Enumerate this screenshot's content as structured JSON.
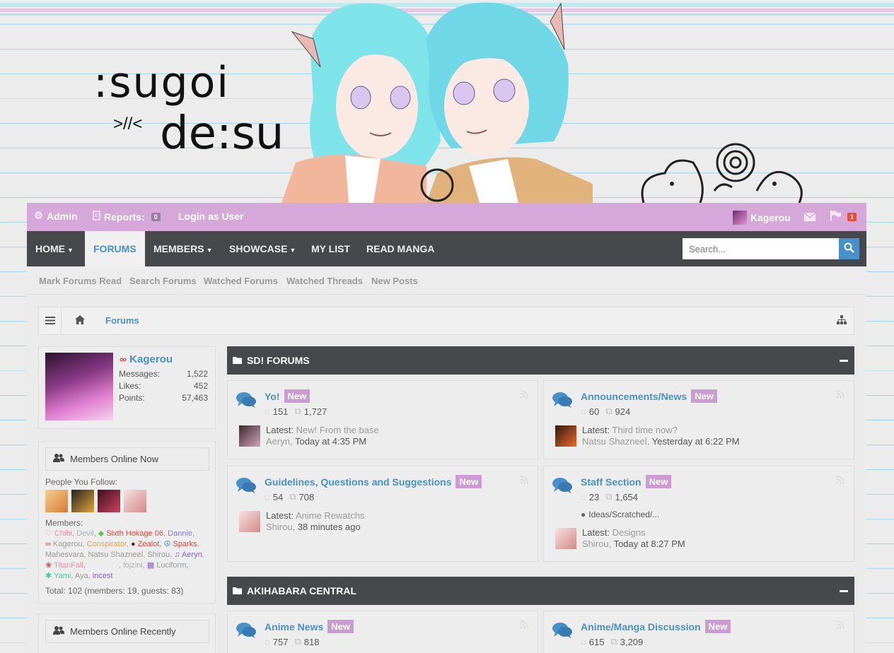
{
  "header": {
    "logo_line1": ":sugoi",
    "logo_emote": ">//<",
    "logo_line2": "de:su"
  },
  "admin_bar": {
    "admin_label": "Admin",
    "reports_label": "Reports:",
    "reports_count": "0",
    "login_as_user": "Login as User",
    "username": "Kagerou",
    "alerts_count": "1"
  },
  "main_nav": {
    "items": [
      {
        "label": "HOME",
        "has_menu": true
      },
      {
        "label": "FORUMS",
        "active": true
      },
      {
        "label": "MEMBERS",
        "has_menu": true
      },
      {
        "label": "SHOWCASE",
        "has_menu": true
      },
      {
        "label": "MY LIST"
      },
      {
        "label": "READ MANGA"
      }
    ],
    "search_placeholder": "Search..."
  },
  "sub_nav": {
    "items": [
      "Mark Forums Read",
      "Search Forums",
      "Watched Forums",
      "Watched Threads",
      "New Posts"
    ]
  },
  "breadcrumb": {
    "current": "Forums"
  },
  "visitor_panel": {
    "name": "Kagerou",
    "stats": [
      {
        "label": "Messages:",
        "value": "1,522"
      },
      {
        "label": "Likes:",
        "value": "452"
      },
      {
        "label": "Points:",
        "value": "57,463"
      }
    ]
  },
  "members_online": {
    "title": "Members Online Now",
    "people_you_follow": "People You Follow:",
    "members_label": "Members:",
    "members": [
      {
        "name": "Chibi",
        "color": "#f08aa6"
      },
      {
        "name": "Devil",
        "color": "#b0b0b0"
      },
      {
        "name": "Sixth Hokage 06",
        "color": "#e0463a"
      },
      {
        "name": "Dannie",
        "color": "#8a7bd6"
      },
      {
        "name": "Kagerou",
        "color": "#999999"
      },
      {
        "name": "Conspirator",
        "color": "#f2a33a"
      },
      {
        "name": "Zealot",
        "color": "#e0463a"
      },
      {
        "name": "Sparks",
        "color": "#e0463a"
      },
      {
        "name": "Mahesvara",
        "color": "#999999"
      },
      {
        "name": "Natsu Shazneel",
        "color": "#999999"
      },
      {
        "name": "Shirou",
        "color": "#999999"
      },
      {
        "name": "Aeryn",
        "color": "#8a5bd6"
      },
      {
        "name": "TitanFall",
        "color": "#f08aa6"
      },
      {
        "name": "lojzini",
        "color": "#b0b0b0"
      },
      {
        "name": "Luciform",
        "color": "#999999"
      },
      {
        "name": "Yami",
        "color": "#3fc9a0"
      },
      {
        "name": "Aya",
        "color": "#999999"
      },
      {
        "name": "incest",
        "color": "#8a5bd6"
      }
    ],
    "total": "Total: 102 (members: 19, guests: 83)"
  },
  "members_recent": {
    "title": "Members Online Recently"
  },
  "categories": [
    {
      "title": "SD! FORUMS",
      "nodes": [
        {
          "title": "Yo!",
          "badge": "New",
          "threads": "151",
          "messages": "1,727",
          "latest_label": "Latest:",
          "latest_title": "New! From the base",
          "latest_user": "Aeryn",
          "latest_time": "Today at 4:35 PM"
        },
        {
          "title": "Announcements/News",
          "badge": "New",
          "threads": "60",
          "messages": "924",
          "latest_label": "Latest:",
          "latest_title": "Third time now?",
          "latest_user": "Natsu Shazneel",
          "latest_time": "Yesterday at 6:22 PM"
        },
        {
          "title": "Guidelines, Questions and Suggestions",
          "badge": "New",
          "threads": "54",
          "messages": "708",
          "latest_label": "Latest:",
          "latest_title": "Anime Rewatchs",
          "latest_user": "Shirou",
          "latest_time": "38 minutes ago"
        },
        {
          "title": "Staff Section",
          "badge": "New",
          "threads": "23",
          "messages": "1,654",
          "subforum": "Ideas/Scratched/...",
          "latest_label": "Latest:",
          "latest_title": "Designs",
          "latest_user": "Shirou",
          "latest_time": "Today at 8:27 PM"
        }
      ]
    },
    {
      "title": "AKIHABARA CENTRAL",
      "nodes": [
        {
          "title": "Anime News",
          "badge": "New",
          "threads": "757",
          "messages": "818"
        },
        {
          "title": "Anime/Manga Discussion",
          "badge": "New",
          "threads": "615",
          "messages": "3,209"
        }
      ]
    }
  ],
  "colors": {
    "accent": "#4a90c8",
    "admin_bar": "#d5a8d9",
    "nav_dark": "#46484b",
    "new_badge": "#cc9bd1",
    "alert_red": "#e74c3c"
  }
}
